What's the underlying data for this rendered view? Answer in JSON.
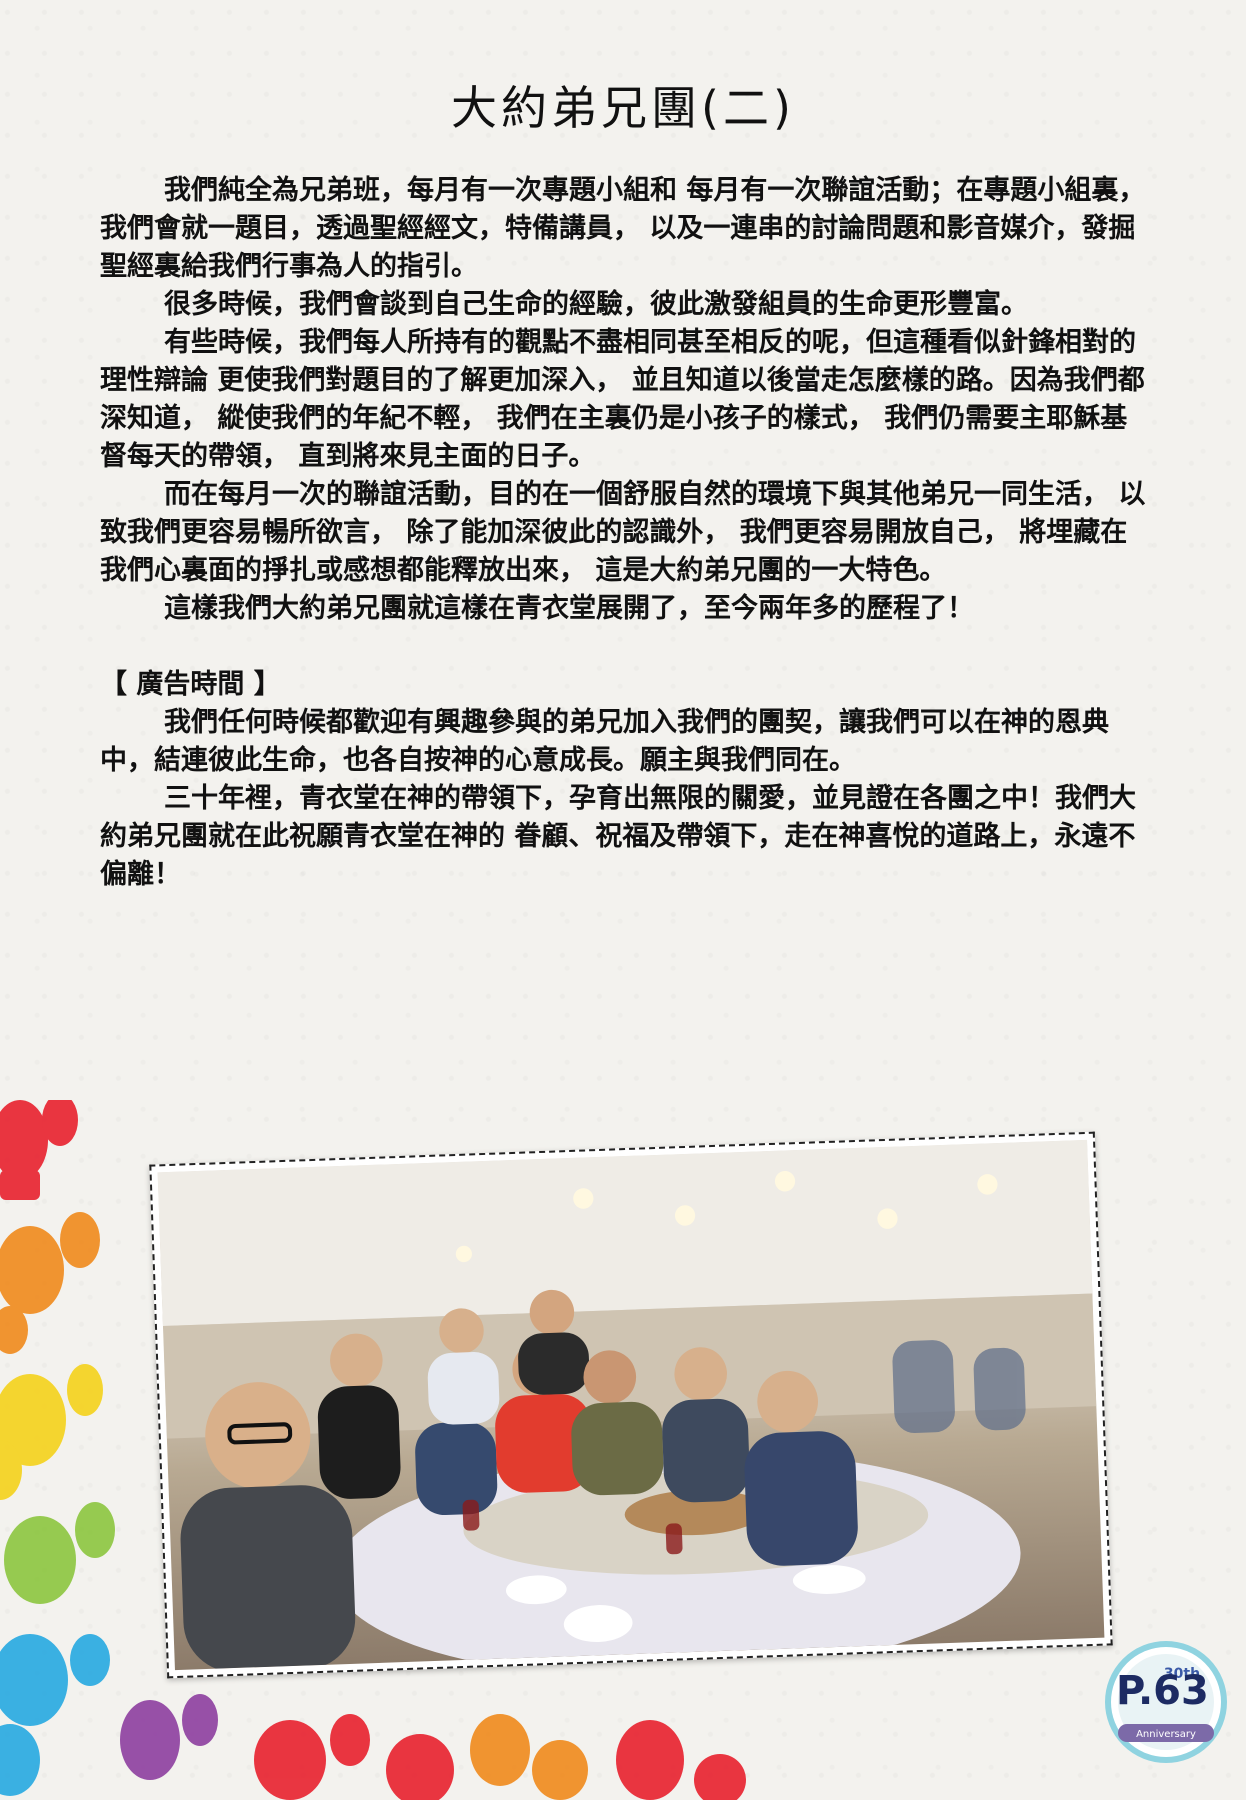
{
  "title": "大約弟兄團(二)",
  "paragraphs": [
    "我們純全為兄弟班，每月有一次專題小組和 每月有一次聯誼活動；在專題小組裏，我們會就一題目，透過聖經經文，特備講員， 以及一連串的討論問題和影音媒介，發掘聖經裏給我們行事為人的指引。",
    "很多時候，我們會談到自己生命的經驗，彼此激發組員的生命更形豐富。",
    "有些時候，我們每人所持有的觀點不盡相同甚至相反的呢，但這種看似針鋒相對的理性辯論 更使我們對題目的了解更加深入， 並且知道以後當走怎麼樣的路。因為我們都深知道， 縱使我們的年紀不輕， 我們在主裏仍是小孩子的樣式， 我們仍需要主耶穌基督每天的帶領， 直到將來見主面的日子。",
    "而在每月一次的聯誼活動，目的在一個舒服自然的環境下與其他弟兄一同生活， 以致我們更容易暢所欲言， 除了能加深彼此的認識外， 我們更容易開放自己， 將埋藏在我們心裏面的掙扎或感想都能釋放出來， 這是大約弟兄團的一大特色。",
    "這樣我們大約弟兄團就這樣在青衣堂展開了，至今兩年多的歷程了！"
  ],
  "ad": {
    "heading": "【 廣告時間 】",
    "paragraphs": [
      "我們任何時候都歡迎有興趣參與的弟兄加入我們的團契，讓我們可以在神的恩典中，結連彼此生命，也各自按神的心意成長。願主與我們同在。",
      "三十年裡，青衣堂在神的帶領下，孕育出無限的關愛，並見證在各團之中！我們大約弟兄團就在此祝願青衣堂在神的 眷顧、祝福及帶領下，走在神喜悅的道路上，永遠不偏離！"
    ]
  },
  "photo": {
    "alt": "group-photo-dinner"
  },
  "badge": {
    "page_label": "P.63",
    "ribbon_text": "Anniversary",
    "number_text": "30th"
  },
  "colors": {
    "page_bg": "#f3f2ee",
    "text": "#111111",
    "badge_ring": "#8fd3e0",
    "page_number": "#1d2b63"
  }
}
